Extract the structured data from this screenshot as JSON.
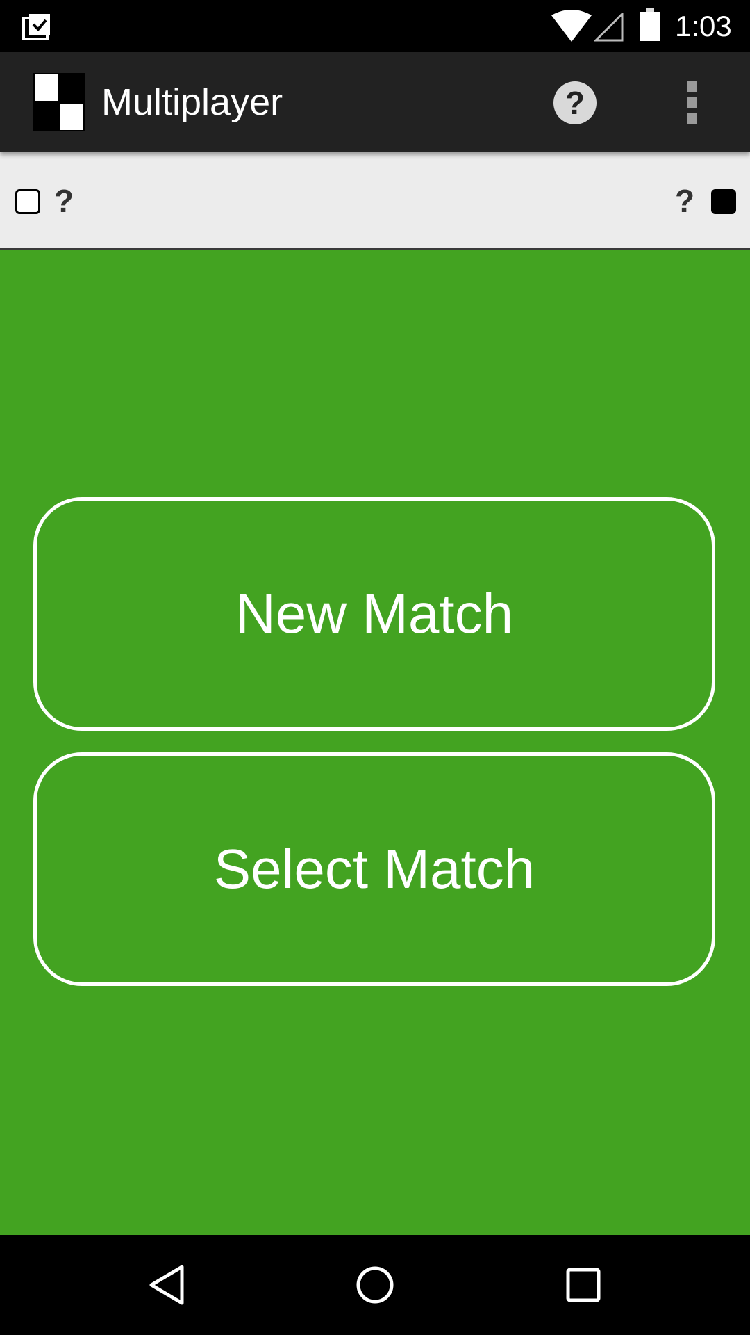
{
  "status_bar": {
    "time": "1:03",
    "icons": [
      "clipboard-check-icon",
      "wifi-icon",
      "cell-signal-icon",
      "battery-icon"
    ]
  },
  "app_bar": {
    "title": "Multiplayer",
    "logo_icon": "checkerboard-logo-icon",
    "help_label": "?",
    "overflow_icon": "more-vert-icon"
  },
  "score_strip": {
    "white_player_score": "?",
    "black_player_score": "?"
  },
  "main": {
    "new_match_label": "New Match",
    "select_match_label": "Select Match"
  },
  "nav_bar": {
    "icons": [
      "back-icon",
      "home-icon",
      "recents-icon"
    ]
  },
  "colors": {
    "background_green": "#43a321",
    "app_bar": "#222222",
    "score_strip": "#ececec",
    "button_outline": "#ffffff"
  }
}
